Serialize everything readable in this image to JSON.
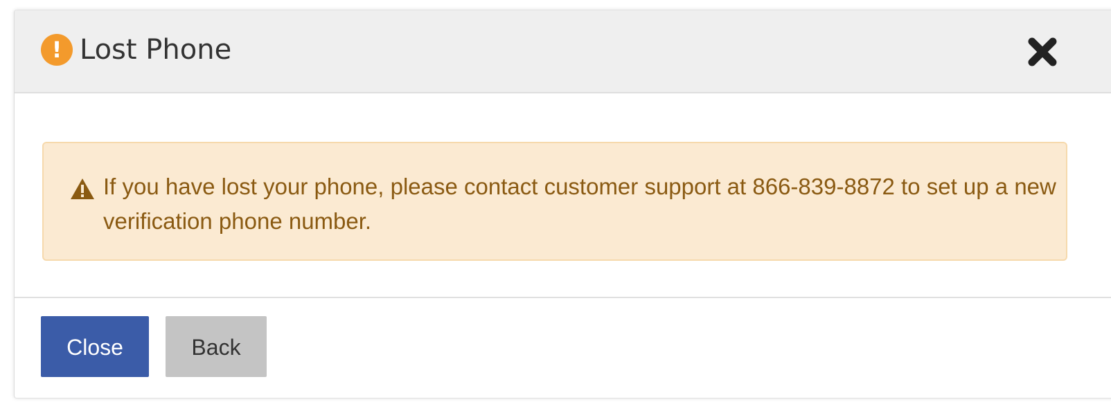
{
  "modal": {
    "title": "Lost Phone",
    "header_icon": "exclamation-circle-icon",
    "header_icon_glyph": "!",
    "close_icon": "close-x-icon"
  },
  "alert": {
    "icon": "warning-triangle-icon",
    "message": "If you have lost your phone, please contact customer support at 866-839-8872 to set up a new verification phone number."
  },
  "footer": {
    "close_label": "Close",
    "back_label": "Back"
  },
  "colors": {
    "header_icon": "#f39a2c",
    "alert_background": "#fbead2",
    "alert_border": "#f6d9ac",
    "alert_text": "#8a5a12",
    "primary_button": "#3b5ca8",
    "secondary_button": "#c4c4c4"
  }
}
